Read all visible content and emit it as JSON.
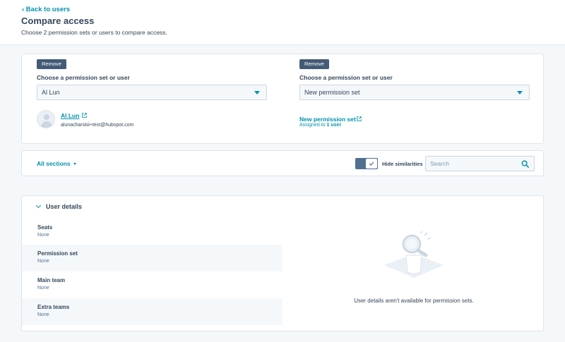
{
  "header": {
    "back_label": "‹ Back to users",
    "title": "Compare access",
    "subtitle": "Choose 2 permission sets or users to compare access."
  },
  "compare": {
    "left": {
      "remove_label": "Remove",
      "choose_label": "Choose a permission set or user",
      "selected": "Al Lun",
      "user_name": "Al Lun",
      "user_email": "alunacharskii+test@hubspot.com"
    },
    "right": {
      "remove_label": "Remove",
      "choose_label": "Choose a permission set or user",
      "selected": "New permission set",
      "set_name": "New permission set",
      "assigned_prefix": "Assigned to",
      "assigned_count": "1 user"
    }
  },
  "filter": {
    "sections_label": "All sections",
    "toggle_label": "Hide similarities",
    "toggle_on": true,
    "search_placeholder": "Search"
  },
  "user_details": {
    "title": "User details",
    "rows": [
      {
        "label": "Seats",
        "value": "None"
      },
      {
        "label": "Permission set",
        "value": "None"
      },
      {
        "label": "Main team",
        "value": "None"
      },
      {
        "label": "Extra teams",
        "value": "None"
      }
    ],
    "empty_message": "User details aren't available for permission sets."
  },
  "colors": {
    "accent": "#0091ae",
    "button_dark": "#425b76",
    "text": "#33475b"
  }
}
